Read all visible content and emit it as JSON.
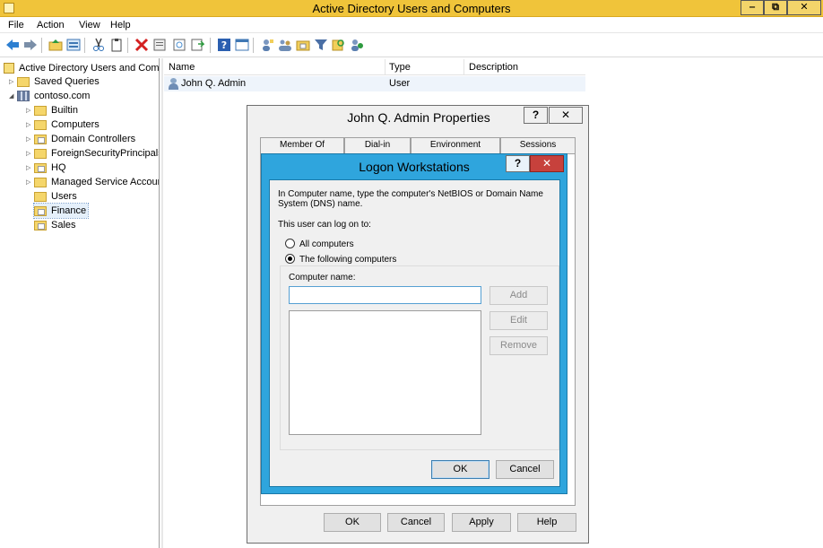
{
  "window": {
    "title": "Active Directory Users and Computers",
    "min_glyph": "‒",
    "max_glyph": "⧉",
    "close_glyph": "✕"
  },
  "menu": [
    "File",
    "Action",
    "View",
    "Help"
  ],
  "toolbar_icons": [
    "back-arrow-icon",
    "forward-arrow-icon",
    "up-folder-icon",
    "details-view-icon",
    "cut-icon",
    "clipboard-icon",
    "delete-icon",
    "properties-icon",
    "export-list-icon",
    "refresh-icon",
    "help-icon",
    "console-icon",
    "new-user-icon",
    "new-group-icon",
    "new-ou-icon",
    "filter-icon",
    "find-icon",
    "add-to-group-icon"
  ],
  "tree": {
    "root": "Active Directory Users and Com",
    "items": [
      {
        "label": "Saved Queries",
        "level": 1,
        "expander": "▷"
      },
      {
        "label": "contoso.com",
        "level": 1,
        "expander": "◢"
      },
      {
        "label": "Builtin",
        "level": 2,
        "expander": "▷"
      },
      {
        "label": "Computers",
        "level": 2,
        "expander": "▷"
      },
      {
        "label": "Domain Controllers",
        "level": 2,
        "expander": "▷"
      },
      {
        "label": "ForeignSecurityPrincipals",
        "level": 2,
        "expander": "▷"
      },
      {
        "label": "HQ",
        "level": 2,
        "expander": "▷"
      },
      {
        "label": "Managed Service Accour",
        "level": 2,
        "expander": "▷"
      },
      {
        "label": "Users",
        "level": 2,
        "expander": ""
      },
      {
        "label": "Finance",
        "level": 2,
        "expander": ""
      },
      {
        "label": "Sales",
        "level": 2,
        "expander": ""
      }
    ]
  },
  "list": {
    "columns": [
      "Name",
      "Type",
      "Description"
    ],
    "rows": [
      {
        "name": "John Q. Admin",
        "type": "User",
        "description": ""
      }
    ]
  },
  "properties_dialog": {
    "title": "John Q. Admin Properties",
    "help_glyph": "?",
    "close_glyph": "✕",
    "tabs": [
      "Member Of",
      "Dial-in",
      "Environment",
      "Sessions"
    ],
    "buttons": {
      "ok": "OK",
      "cancel": "Cancel",
      "apply": "Apply",
      "help": "Help"
    }
  },
  "logon_dialog": {
    "title": "Logon Workstations",
    "help_glyph": "?",
    "close_glyph": "✕",
    "instructions": "In Computer name, type the computer's NetBIOS or Domain Name System (DNS) name.",
    "can_logon_label": "This user can log on to:",
    "option_all": "All computers",
    "option_following": "The following computers",
    "selected_option": "The following computers",
    "computer_name_label": "Computer name:",
    "computer_name_value": "",
    "buttons": {
      "add": "Add",
      "edit": "Edit",
      "remove": "Remove",
      "ok": "OK",
      "cancel": "Cancel"
    }
  },
  "colors": {
    "titlebar": "#f0c43a",
    "dialog_accent": "#2fa5dd",
    "close_red": "#c7413c"
  }
}
